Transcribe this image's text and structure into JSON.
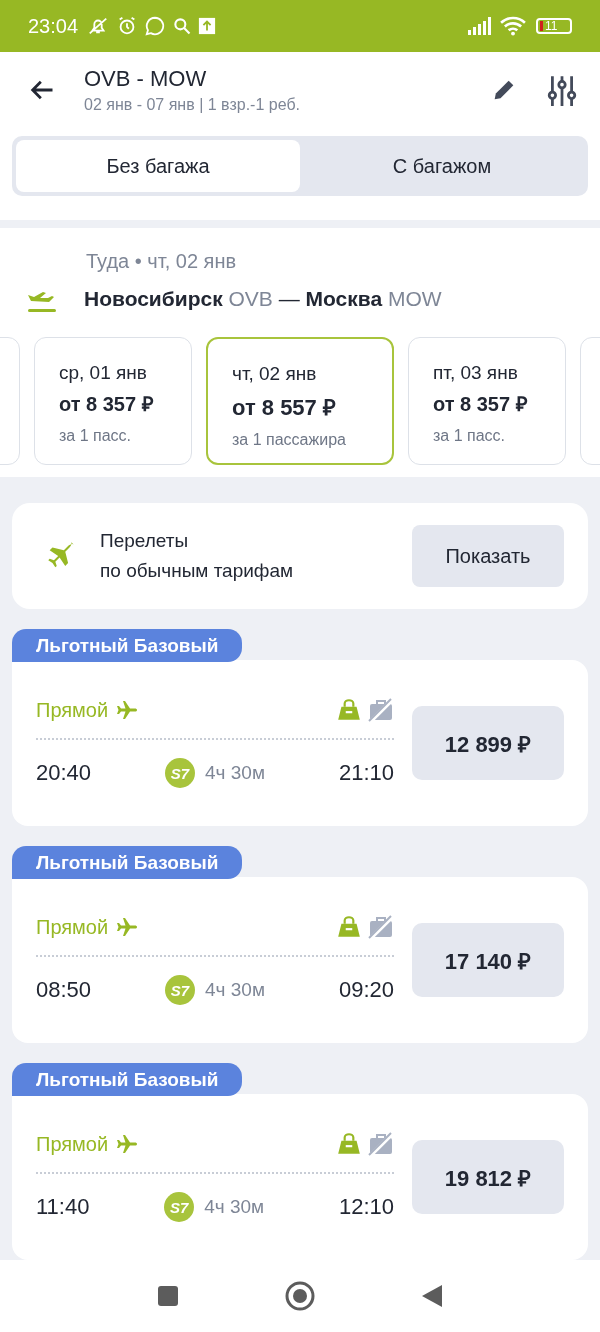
{
  "status_bar": {
    "time": "23:04",
    "battery": "11"
  },
  "header": {
    "title": "OVB - MOW",
    "subtitle": "02 янв - 07 янв | 1 взр.-1 реб."
  },
  "tabs": [
    {
      "label": "Без багажа",
      "selected": true
    },
    {
      "label": "С багажом",
      "selected": false
    }
  ],
  "direction": {
    "label": "Туда • чт, 02 янв",
    "from_city": "Новосибирск",
    "from_code": "OVB",
    "separator": "—",
    "to_city": "Москва",
    "to_code": "MOW"
  },
  "dates": [
    {
      "date": "ср, 01 янв",
      "price": "от 8 357 ₽",
      "note": "за 1 пасс.",
      "selected": false
    },
    {
      "date": "чт, 02 янв",
      "price": "от 8 557 ₽",
      "note": "за 1 пассажира",
      "selected": true
    },
    {
      "date": "пт, 03 янв",
      "price": "от 8 357 ₽",
      "note": "за 1 пасс.",
      "selected": false
    }
  ],
  "promo": {
    "text": "Перелеты\nпо обычным тарифам",
    "button": "Показать"
  },
  "flights": [
    {
      "tag": "Льготный Базовый",
      "type": "Прямой",
      "hand_luggage": true,
      "baggage": false,
      "depart": "20:40",
      "airline": "S7",
      "duration": "4ч 30м",
      "arrive": "21:10",
      "price": "12 899 ₽"
    },
    {
      "tag": "Льготный Базовый",
      "type": "Прямой",
      "hand_luggage": true,
      "baggage": false,
      "depart": "08:50",
      "airline": "S7",
      "duration": "4ч 30м",
      "arrive": "09:20",
      "price": "17 140 ₽"
    },
    {
      "tag": "Льготный Базовый",
      "type": "Прямой",
      "hand_luggage": true,
      "baggage": false,
      "depart": "11:40",
      "airline": "S7",
      "duration": "4ч 30м",
      "arrive": "12:10",
      "price": "19 812 ₽"
    }
  ]
}
